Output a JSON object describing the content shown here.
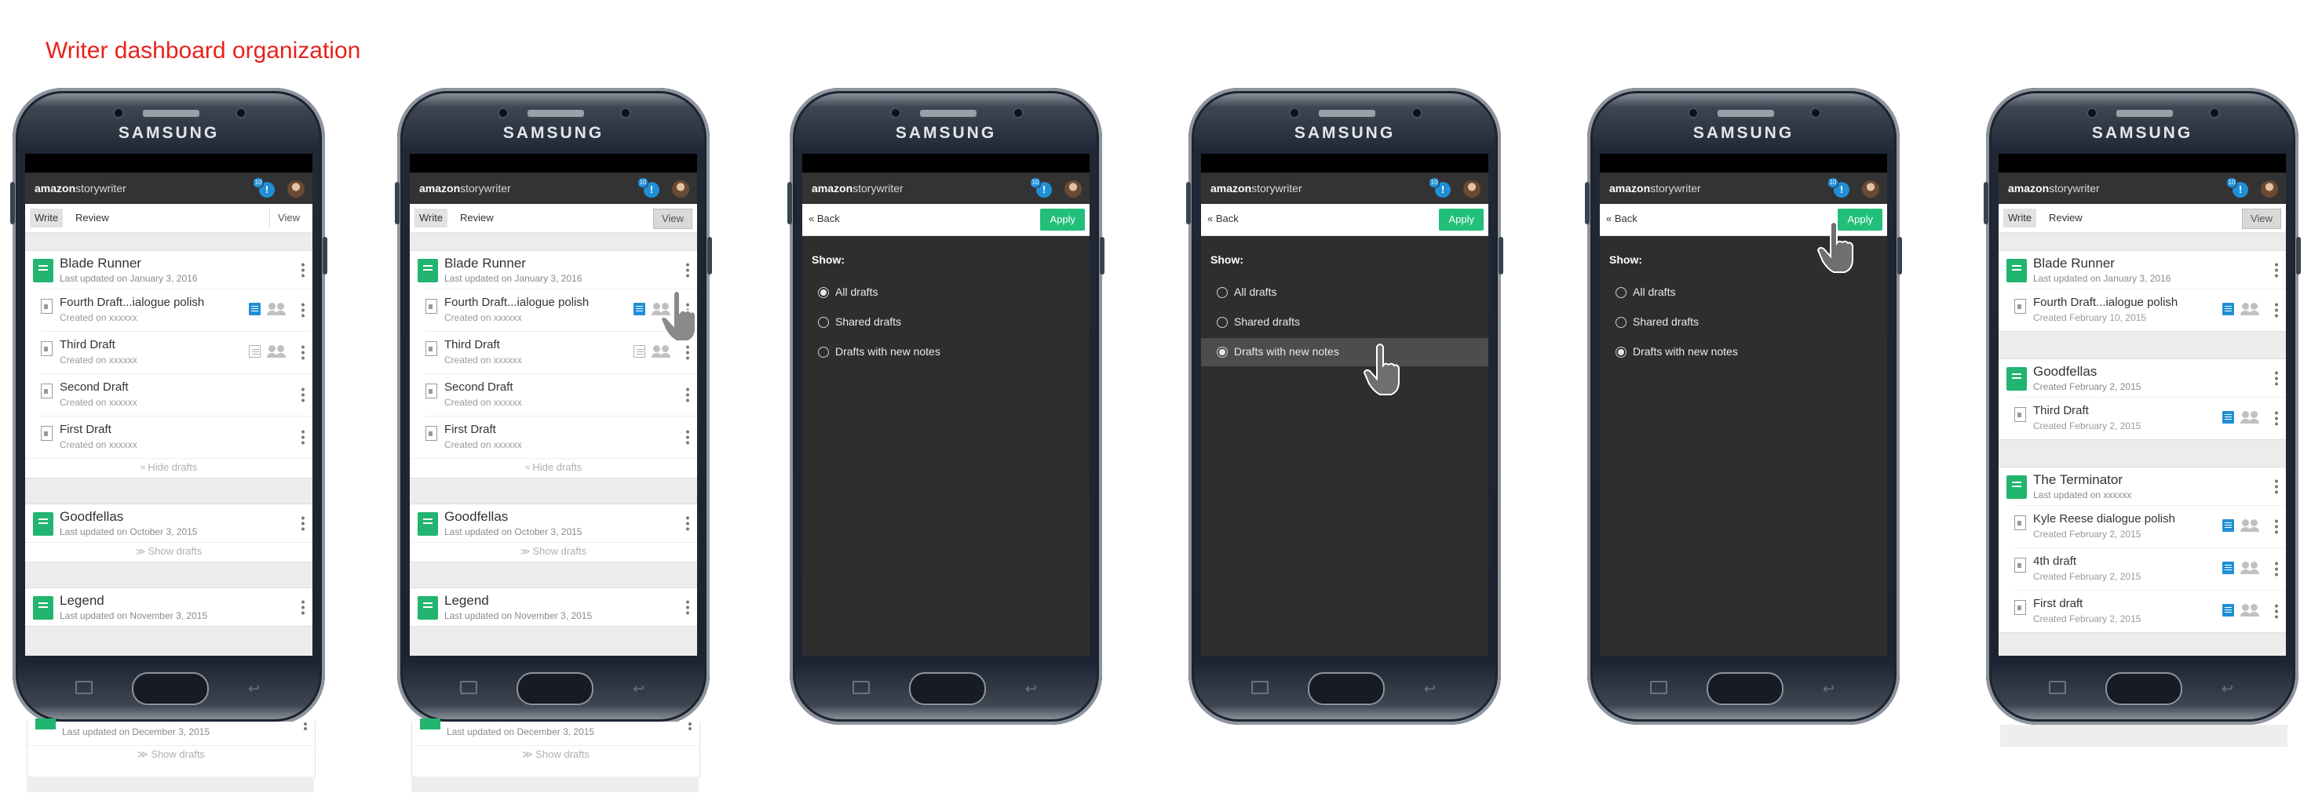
{
  "page": {
    "title": "Writer dashboard organization"
  },
  "device": {
    "brand": "SAMSUNG"
  },
  "app": {
    "logo_bold": "amazon",
    "logo_rest": "storywriter",
    "notification_count": "10",
    "notification_glyph": "!"
  },
  "tabs": {
    "write": "Write",
    "review": "Review",
    "view": "View"
  },
  "toggle": {
    "hide": "Hide drafts",
    "show": "Show drafts",
    "hide_icon": "≈",
    "show_icon": "≫"
  },
  "dashboard": {
    "projects": [
      {
        "title": "Blade Runner",
        "updated": "Last updated on January 3, 2016",
        "drafts": [
          {
            "title": "Fourth Draft...ialogue polish",
            "created": "Created on xxxxxx",
            "notes": true
          },
          {
            "title": "Third Draft",
            "created": "Created on xxxxxx",
            "notes": false
          },
          {
            "title": "Second Draft",
            "created": "Created on xxxxxx"
          },
          {
            "title": "First Draft",
            "created": "Created on xxxxxx"
          }
        ]
      },
      {
        "title": "Goodfellas",
        "updated": "Last updated on October 3, 2015"
      },
      {
        "title": "Legend",
        "updated": "Last updated on November 3, 2015"
      },
      {
        "updated": "Last updated on December 3, 2015"
      }
    ]
  },
  "filter": {
    "back": "Back",
    "apply": "Apply",
    "show_label": "Show:",
    "options": [
      "All drafts",
      "Shared drafts",
      "Drafts with new notes"
    ]
  },
  "filtered": {
    "projects": [
      {
        "title": "Blade Runner",
        "updated": "Last updated on January 3, 2016",
        "drafts": [
          {
            "title": "Fourth Draft...ialogue polish",
            "created": "Created February 10, 2015"
          }
        ]
      },
      {
        "title": "Goodfellas",
        "updated": "Created February 2, 2015",
        "drafts": [
          {
            "title": "Third Draft",
            "created": "Created February 2, 2015"
          }
        ]
      },
      {
        "title": "The Terminator",
        "updated": "Last updated on xxxxxx",
        "drafts": [
          {
            "title": "Kyle Reese dialogue polish",
            "created": "Created February 2, 2015"
          },
          {
            "title": "4th draft",
            "created": "Created February 2, 2015"
          },
          {
            "title": "First draft",
            "created": "Created February 2, 2015"
          }
        ]
      }
    ]
  },
  "colors": {
    "title_red": "#e8221c",
    "accent_green": "#22bf7a",
    "note_blue": "#1f8fd6",
    "app_bar": "#333333",
    "filter_bg": "#2e2e2e"
  }
}
